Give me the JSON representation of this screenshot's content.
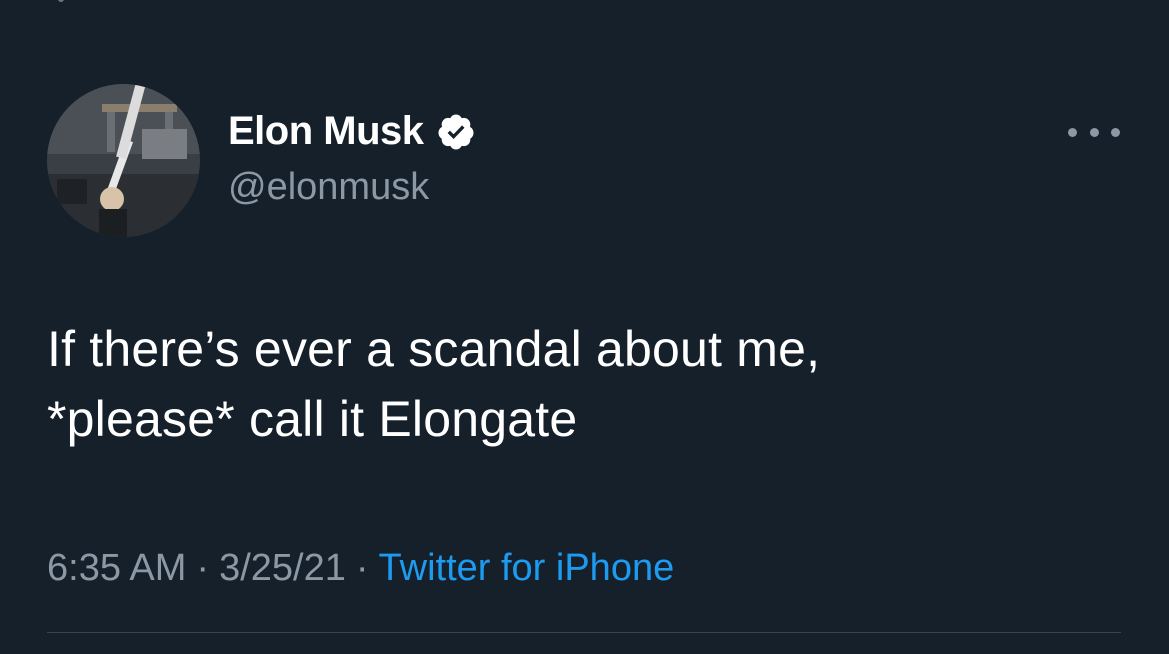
{
  "tweet": {
    "author": {
      "display_name": "Elon Musk",
      "handle": "@elonmusk",
      "verified": true,
      "avatar_icon": "profile-photo"
    },
    "more_icon": "ellipsis-icon",
    "text_lines": [
      "If there’s ever a scandal about me,",
      "*please* call it Elongate"
    ],
    "time": "6:35 AM",
    "date": "3/25/21",
    "separator": "·",
    "source": "Twitter for iPhone"
  },
  "colors": {
    "background": "#15202b",
    "primary_text": "#ffffff",
    "secondary_text": "#8b98a5",
    "link": "#1d9bf0",
    "divider": "#38444d"
  }
}
